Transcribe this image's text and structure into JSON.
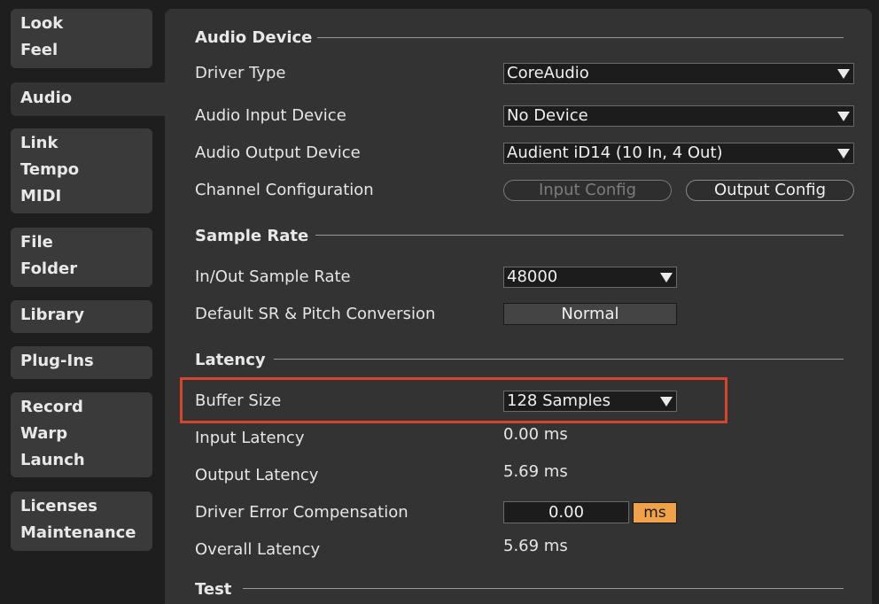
{
  "sidebar": {
    "groups": [
      {
        "items": [
          "Look",
          "Feel"
        ]
      },
      {
        "items": [
          "Audio"
        ]
      },
      {
        "items": [
          "Link",
          "Tempo",
          "MIDI"
        ]
      },
      {
        "items": [
          "File",
          "Folder"
        ]
      },
      {
        "items": [
          "Library"
        ]
      },
      {
        "items": [
          "Plug-Ins"
        ]
      },
      {
        "items": [
          "Record",
          "Warp",
          "Launch"
        ]
      },
      {
        "items": [
          "Licenses",
          "Maintenance"
        ]
      }
    ],
    "active": "Audio"
  },
  "audio_device": {
    "heading": "Audio Device",
    "driver_type": {
      "label": "Driver Type",
      "value": "CoreAudio"
    },
    "input_device": {
      "label": "Audio Input Device",
      "value": "No Device"
    },
    "output_device": {
      "label": "Audio Output Device",
      "value": "Audient iD14 (10 In, 4 Out)"
    },
    "channel_config": {
      "label": "Channel Configuration",
      "input_button": "Input Config",
      "output_button": "Output Config"
    }
  },
  "sample_rate": {
    "heading": "Sample Rate",
    "in_out": {
      "label": "In/Out Sample Rate",
      "value": "48000"
    },
    "conversion": {
      "label": "Default SR & Pitch Conversion",
      "value": "Normal"
    }
  },
  "latency": {
    "heading": "Latency",
    "buffer_size": {
      "label": "Buffer Size",
      "value": "128 Samples"
    },
    "input_latency": {
      "label": "Input Latency",
      "value": "0.00 ms"
    },
    "output_latency": {
      "label": "Output Latency",
      "value": "5.69 ms"
    },
    "driver_error": {
      "label": "Driver Error Compensation",
      "value": "0.00",
      "unit": "ms"
    },
    "overall_latency": {
      "label": "Overall Latency",
      "value": "5.69 ms"
    }
  },
  "test": {
    "heading": "Test"
  },
  "colors": {
    "accent": "#f0a24a",
    "highlight": "#d4452e"
  }
}
